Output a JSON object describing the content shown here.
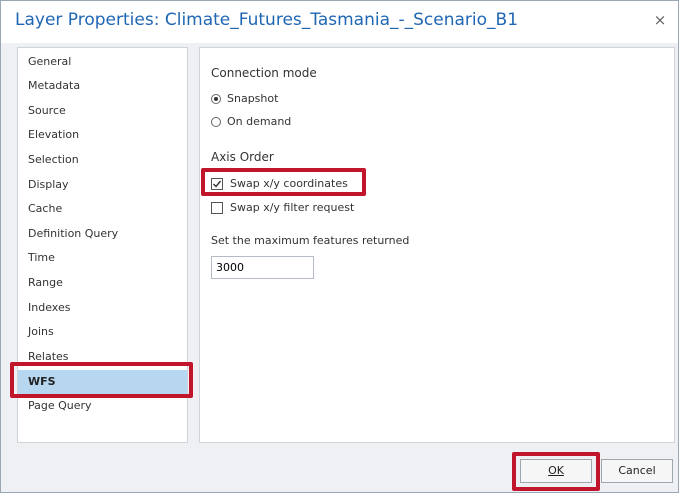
{
  "window": {
    "title": "Layer Properties: Climate_Futures_Tasmania_-_Scenario_B1",
    "close_glyph": "×"
  },
  "nav": {
    "items": [
      {
        "label": "General"
      },
      {
        "label": "Metadata"
      },
      {
        "label": "Source"
      },
      {
        "label": "Elevation"
      },
      {
        "label": "Selection"
      },
      {
        "label": "Display"
      },
      {
        "label": "Cache"
      },
      {
        "label": "Definition Query"
      },
      {
        "label": "Time"
      },
      {
        "label": "Range"
      },
      {
        "label": "Indexes"
      },
      {
        "label": "Joins"
      },
      {
        "label": "Relates"
      },
      {
        "label": "WFS",
        "selected": true
      },
      {
        "label": "Page Query"
      }
    ]
  },
  "wfs": {
    "connection_mode": {
      "title": "Connection mode",
      "options": [
        {
          "label": "Snapshot",
          "selected": true
        },
        {
          "label": "On demand",
          "selected": false
        }
      ]
    },
    "axis_order": {
      "title": "Axis Order",
      "swap_coordinates": {
        "label": "Swap x/y coordinates",
        "checked": true
      },
      "swap_filter": {
        "label": "Swap x/y filter request",
        "checked": false
      }
    },
    "max_features": {
      "label": "Set the maximum features returned",
      "value": "3000"
    }
  },
  "buttons": {
    "ok": "OK",
    "cancel": "Cancel"
  },
  "colors": {
    "highlight": "#c0152a",
    "title": "#1f66b3",
    "selected_nav": "#b7d6ef"
  }
}
